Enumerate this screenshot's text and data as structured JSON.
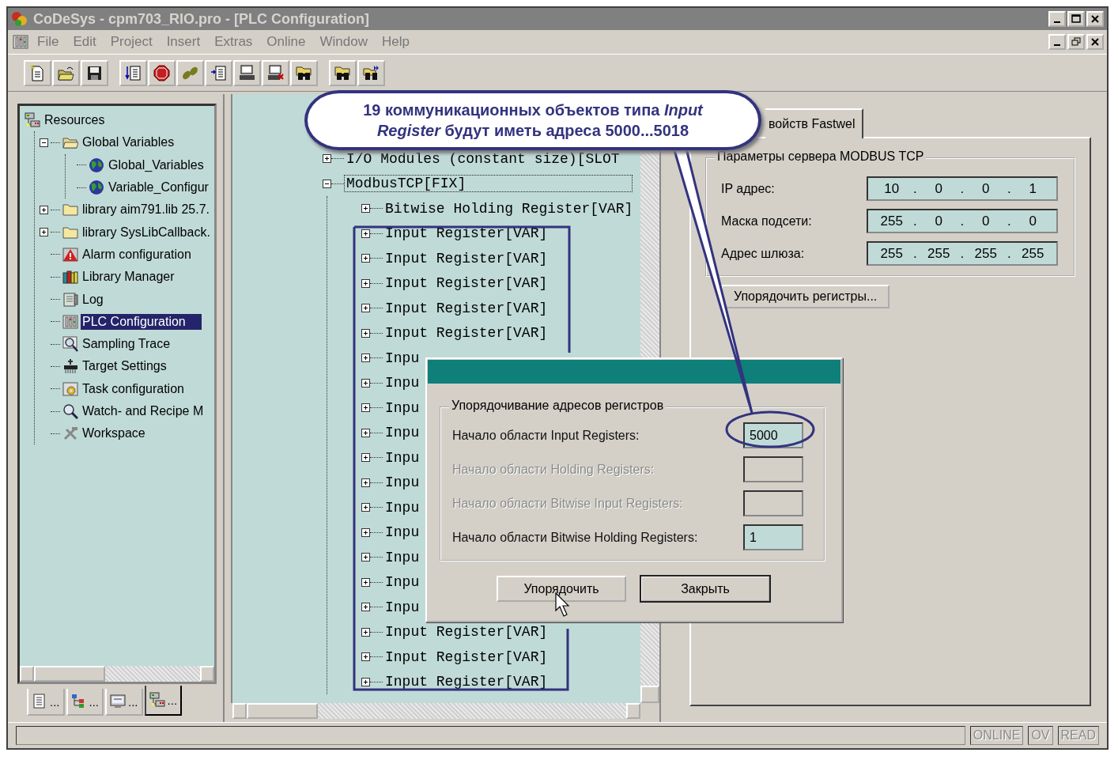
{
  "window": {
    "title": "CoDeSys - cpm703_RIO.pro - [PLC Configuration]"
  },
  "menu": [
    "File",
    "Edit",
    "Project",
    "Insert",
    "Extras",
    "Online",
    "Window",
    "Help"
  ],
  "toolbar": [
    [
      {
        "kind": "new"
      },
      {
        "kind": "open"
      },
      {
        "kind": "save"
      }
    ],
    [
      {
        "kind": "download"
      },
      {
        "kind": "stop"
      },
      {
        "kind": "step"
      },
      {
        "kind": "upload"
      },
      {
        "kind": "connect"
      },
      {
        "kind": "disconnect"
      },
      {
        "kind": "find"
      }
    ],
    [
      {
        "kind": "find"
      },
      {
        "kind": "find-next"
      }
    ]
  ],
  "resources_tree": [
    {
      "label": "Resources",
      "kind": "resources",
      "selected": false,
      "children": [
        {
          "label": "Global Variables",
          "kind": "folder-open",
          "expanded": true,
          "selected": false,
          "children": [
            {
              "label": "Global_Variables",
              "kind": "globe",
              "selected": false
            },
            {
              "label": "Variable_Configur",
              "kind": "globe",
              "selected": false
            }
          ]
        },
        {
          "label": "library aim791.lib 25.7.",
          "kind": "folder",
          "expanded": false,
          "selected": false
        },
        {
          "label": "library SysLibCallback.",
          "kind": "folder",
          "expanded": false,
          "selected": false
        },
        {
          "label": "Alarm configuration",
          "kind": "alarm",
          "selected": false
        },
        {
          "label": "Library Manager",
          "kind": "library",
          "selected": false
        },
        {
          "label": "Log",
          "kind": "log",
          "selected": false
        },
        {
          "label": "PLC Configuration",
          "kind": "plc",
          "selected": true
        },
        {
          "label": "Sampling Trace",
          "kind": "trace",
          "selected": false
        },
        {
          "label": "Target Settings",
          "kind": "target",
          "selected": false
        },
        {
          "label": "Task configuration",
          "kind": "task",
          "selected": false
        },
        {
          "label": "Watch- and Recipe M",
          "kind": "watch",
          "selected": false
        },
        {
          "label": "Workspace",
          "kind": "workspace",
          "selected": false
        }
      ]
    }
  ],
  "object_tabs": [
    {
      "label": "...",
      "kind": "pou",
      "selected": false
    },
    {
      "label": "...",
      "kind": "types",
      "selected": false
    },
    {
      "label": "...",
      "kind": "visual",
      "selected": false
    },
    {
      "label": "...",
      "kind": "resources",
      "selected": true
    }
  ],
  "config_tree": [
    {
      "label": "I/O Modules (constant size)[SLOT",
      "expanded": false,
      "selected": false
    },
    {
      "label": "ModbusTCP[FIX]",
      "expanded": true,
      "selected": true,
      "children": [
        {
          "label": "Bitwise Holding Register[VAR]",
          "expanded": false,
          "selected": false
        },
        {
          "label": "Input Register[VAR]",
          "expanded": false,
          "selected": false
        },
        {
          "label": "Input Register[VAR]",
          "expanded": false,
          "selected": false
        },
        {
          "label": "Input Register[VAR]",
          "expanded": false,
          "selected": false
        },
        {
          "label": "Input Register[VAR]",
          "expanded": false,
          "selected": false
        },
        {
          "label": "Input Register[VAR]",
          "expanded": false,
          "selected": false
        },
        {
          "label": "Inpu",
          "expanded": false,
          "selected": false
        },
        {
          "label": "Inpu",
          "expanded": false,
          "selected": false
        },
        {
          "label": "Inpu",
          "expanded": false,
          "selected": false
        },
        {
          "label": "Inpu",
          "expanded": false,
          "selected": false
        },
        {
          "label": "Inpu",
          "expanded": false,
          "selected": false
        },
        {
          "label": "Inpu",
          "expanded": false,
          "selected": false
        },
        {
          "label": "Inpu",
          "expanded": false,
          "selected": false
        },
        {
          "label": "Inpu",
          "expanded": false,
          "selected": false
        },
        {
          "label": "Inpu",
          "expanded": false,
          "selected": false
        },
        {
          "label": "Inpu",
          "expanded": false,
          "selected": false
        },
        {
          "label": "Inpu",
          "expanded": false,
          "selected": false
        },
        {
          "label": "Input Register[VAR]",
          "expanded": false,
          "selected": false
        },
        {
          "label": "Input Register[VAR]",
          "expanded": false,
          "selected": false
        },
        {
          "label": "Input Register[VAR]",
          "expanded": false,
          "selected": false
        }
      ]
    }
  ],
  "properties": {
    "tabs": [
      {
        "label": "войств Fastwel",
        "selected": true
      }
    ],
    "group_title": "Параметры сервера MODBUS TCP",
    "separator": ".",
    "fields": [
      {
        "label": "IP адрес:",
        "octets": [
          "10",
          "0",
          "0",
          "1"
        ]
      },
      {
        "label": "Маска подсети:",
        "octets": [
          "255",
          "0",
          "0",
          "0"
        ]
      },
      {
        "label": "Адрес шлюза:",
        "octets": [
          "255",
          "255",
          "255",
          "255"
        ]
      }
    ],
    "button": "Упорядочить регистры..."
  },
  "dialog": {
    "group_title": "Упорядочивание адресов регистров",
    "rows": [
      {
        "label": "Начало области Input Registers:",
        "value": "5000",
        "disabled": false
      },
      {
        "label": "Начало области Holding Registers:",
        "disabled": true
      },
      {
        "label": "Начало области Bitwise Input Registers:",
        "disabled": true
      },
      {
        "label": "Начало области Bitwise Holding Registers:",
        "value": "1",
        "disabled": false
      }
    ],
    "buttons": [
      {
        "label": "Упорядочить",
        "default": false
      },
      {
        "label": "Закрыть",
        "default": true
      }
    ]
  },
  "status_bar": {
    "indicators": [
      {
        "label": "ONLINE",
        "active": false
      },
      {
        "label": "OV",
        "active": false
      },
      {
        "label": "READ",
        "active": false
      }
    ]
  },
  "callout": {
    "text": "19 коммуникационных объектов типа *Input Register* будут иметь адреса 5000...5018"
  }
}
